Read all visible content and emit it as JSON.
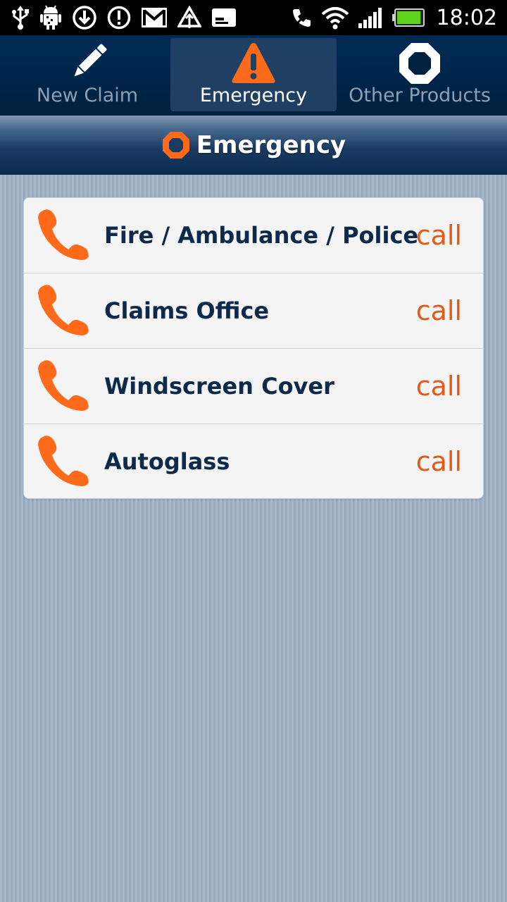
{
  "status_bar": {
    "time": "18:02",
    "icons_left": [
      "usb-icon",
      "android-debug-icon",
      "download-icon",
      "alert-icon",
      "gmail-icon",
      "upload-icon",
      "sd-card-icon"
    ],
    "icons_right": [
      "phone-muted-icon",
      "wifi-icon",
      "signal-icon",
      "battery-icon"
    ],
    "battery_level": 0.95
  },
  "tabs": [
    {
      "label": "New Claim",
      "icon": "pencil-icon",
      "active": false
    },
    {
      "label": "Emergency",
      "icon": "warning-icon",
      "active": true
    },
    {
      "label": "Other Products",
      "icon": "octagon-ring-icon",
      "active": false
    }
  ],
  "header": {
    "title": "Emergency",
    "icon": "octagon-ring-icon"
  },
  "contacts": [
    {
      "name": "Fire / Ambulance / Police",
      "action": "call"
    },
    {
      "name": "Claims Office",
      "action": "call"
    },
    {
      "name": "Windscreen Cover",
      "action": "call"
    },
    {
      "name": "Autoglass",
      "action": "call"
    }
  ],
  "colors": {
    "accent": "#ff6a1a",
    "call_text": "#e35a16",
    "navy": "#0d2a4a",
    "tab_bar": "#002a55",
    "background": "#9db0c4"
  }
}
